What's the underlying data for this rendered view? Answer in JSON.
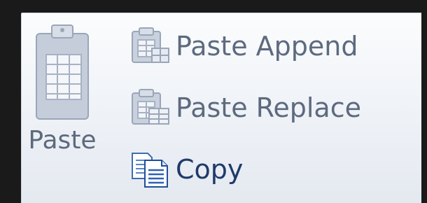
{
  "clipboard_group": {
    "paste": {
      "label": "Paste",
      "icon": "clipboard-icon",
      "enabled": false
    },
    "paste_append": {
      "label": "Paste Append",
      "icon": "paste-append-icon",
      "enabled": false
    },
    "paste_replace": {
      "label": "Paste Replace",
      "icon": "paste-replace-icon",
      "enabled": false
    },
    "copy": {
      "label": "Copy",
      "icon": "copy-icon",
      "enabled": true
    }
  },
  "colors": {
    "disabled_text": "#5d6a7e",
    "enabled_text": "#1f3a6a",
    "background": "#eef2f7"
  }
}
